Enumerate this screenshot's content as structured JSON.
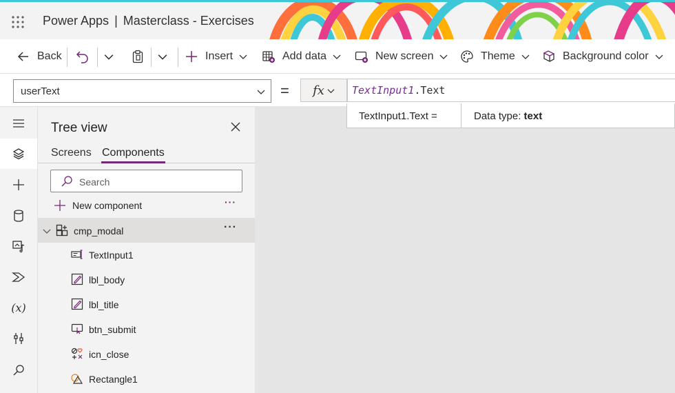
{
  "titlebar": {
    "app_name": "Power Apps",
    "separator": "|",
    "document_title": "Masterclass - Exercises"
  },
  "toolbar": {
    "back": "Back",
    "insert": "Insert",
    "add_data": "Add data",
    "new_screen": "New screen",
    "theme": "Theme",
    "background_color": "Background color"
  },
  "formula_bar": {
    "property": "userText",
    "equals": "=",
    "fx": "fx",
    "formula_identifier": "TextInput1",
    "formula_property": ".Text",
    "intellisense_expression": "TextInput1.Text  =",
    "intellisense_type_label": "Data type:",
    "intellisense_type_value": "text"
  },
  "rail": {
    "items": [
      "menu-icon",
      "tree-view-icon",
      "insert-icon",
      "data-icon",
      "media-icon",
      "power-automate-icon",
      "variables-icon",
      "tools-icon",
      "search-icon"
    ],
    "variables_glyph": "(x)"
  },
  "tree_view": {
    "title": "Tree view",
    "tabs": [
      "Screens",
      "Components"
    ],
    "active_tab": "Components",
    "search_placeholder": "Search",
    "new_component": "New component",
    "more": "···",
    "component": {
      "name": "cmp_modal",
      "more": "···"
    },
    "children": [
      {
        "name": "TextInput1",
        "icon": "text-input-icon"
      },
      {
        "name": "lbl_body",
        "icon": "label-icon"
      },
      {
        "name": "lbl_title",
        "icon": "label-icon"
      },
      {
        "name": "btn_submit",
        "icon": "button-icon"
      },
      {
        "name": "icn_close",
        "icon": "icons-icon"
      },
      {
        "name": "Rectangle1",
        "icon": "shapes-icon"
      }
    ]
  },
  "colors": {
    "accent": "#742774",
    "header_stripe": "#3ec7d7",
    "formula_identifier": "#7a2d94",
    "canvas": "#e5e5e5",
    "panel": "#f3f3f3"
  }
}
